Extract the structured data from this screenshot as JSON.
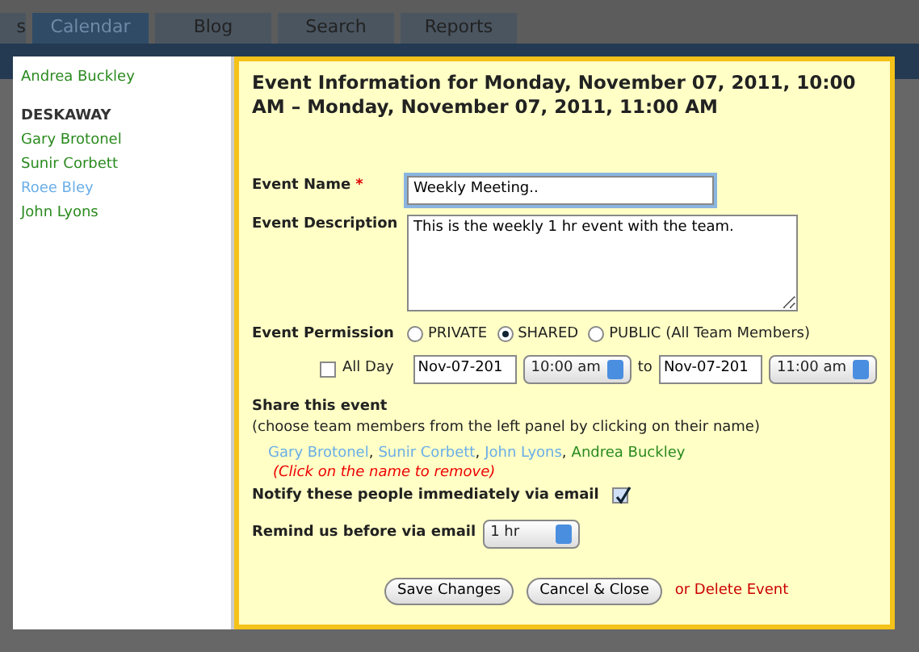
{
  "tabs": [
    {
      "label": "s",
      "selected": false
    },
    {
      "label": "Calendar",
      "selected": true
    },
    {
      "label": "Blog",
      "selected": false
    },
    {
      "label": "Search",
      "selected": false
    },
    {
      "label": "Reports",
      "selected": false
    }
  ],
  "people_panel": {
    "items": [
      {
        "kind": "person",
        "label": "Andrea Buckley",
        "color": "#2a8a1e"
      },
      {
        "kind": "group",
        "label": "DESKAWAY"
      },
      {
        "kind": "person",
        "label": "Gary Brotonel",
        "color": "#2a8a1e"
      },
      {
        "kind": "person",
        "label": "Sunir Corbett",
        "color": "#2a8a1e"
      },
      {
        "kind": "person",
        "label": "Roee Bley",
        "color": "#6aaee8"
      },
      {
        "kind": "person",
        "label": "John Lyons",
        "color": "#2a8a1e"
      }
    ]
  },
  "event": {
    "title": "Event Information for Monday, November 07, 2011, 10:00 AM – Monday, November 07, 2011, 11:00 AM",
    "name_label": "Event Name",
    "required_mark": "*",
    "name_value": "Weekly Meeting..",
    "description_label": "Event Description",
    "description_value": "This is the weekly 1 hr event with the team.",
    "permission_label": "Event Permission",
    "permissions": [
      {
        "label": "PRIVATE",
        "selected": false
      },
      {
        "label": "SHARED",
        "selected": true
      },
      {
        "label": "PUBLIC (All Team Members)",
        "selected": false
      }
    ],
    "all_day": {
      "label": "All Day",
      "checked": false
    },
    "start_date": "Nov-07-201",
    "start_time": "10:00 am",
    "to_label": "to",
    "end_date": "Nov-07-201",
    "end_time": "11:00 am",
    "share_title": "Share this event",
    "share_hint": "(choose team members from the left panel by clicking on their name)",
    "shared_people": [
      {
        "label": "Gary Brotonel",
        "color": "#6aaee8"
      },
      {
        "label": "Sunir Corbett",
        "color": "#6aaee8"
      },
      {
        "label": "John Lyons",
        "color": "#6aaee8"
      },
      {
        "label": "Andrea Buckley",
        "color": "#2a8a1e"
      }
    ],
    "separator": ",",
    "remove_hint": "(Click on the name to remove)",
    "notify": {
      "label": "Notify these people immediately via email",
      "checked": true
    },
    "remind_label": "Remind us before via email",
    "remind_value": "1 hr",
    "buttons": [
      "Save Changes",
      "Cancel & Close"
    ],
    "delete_link": "or Delete Event"
  }
}
